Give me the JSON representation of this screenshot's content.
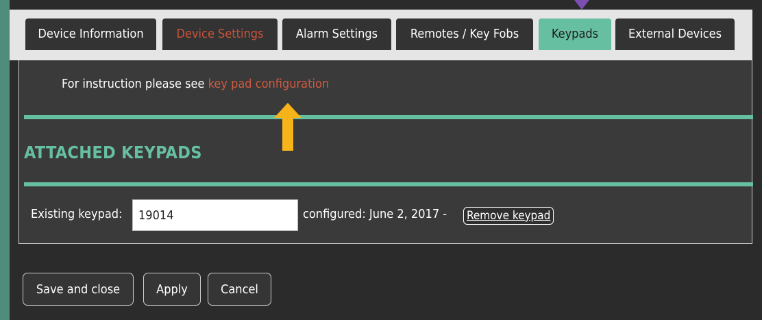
{
  "tabs": [
    {
      "label": "Device Information"
    },
    {
      "label": "Device Settings"
    },
    {
      "label": "Alarm Settings"
    },
    {
      "label": "Remotes / Key Fobs"
    },
    {
      "label": "Keypads",
      "active": true
    },
    {
      "label": "External Devices"
    }
  ],
  "instruction": {
    "text": "For instruction please see ",
    "link_text": "key pad configuration"
  },
  "section": {
    "heading": "ATTACHED KEYPADS"
  },
  "keypad": {
    "label": "Existing keypad:",
    "value": "19014",
    "configured": "configured: June 2, 2017 -",
    "remove_label": "Remove keypad"
  },
  "footer": {
    "save_label": "Save and close",
    "apply_label": "Apply",
    "cancel_label": "Cancel"
  },
  "colors": {
    "accent": "#67bfa1",
    "link": "#cf5a40",
    "arrow": "#f6b41a",
    "marker": "#7a4fb1"
  }
}
